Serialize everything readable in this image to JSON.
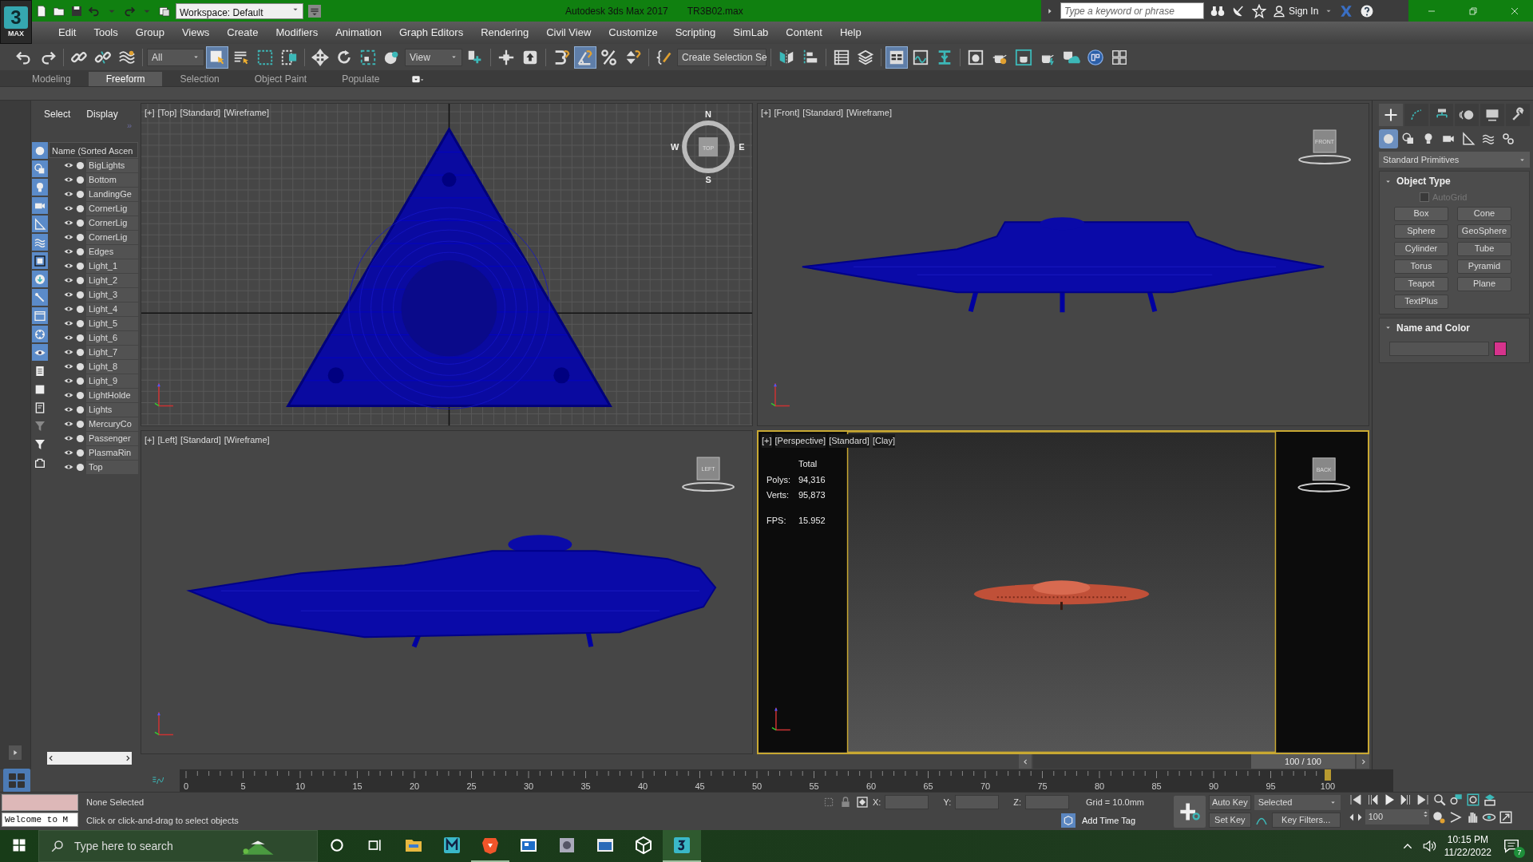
{
  "app_logo": {
    "glyph": "3",
    "label": "MAX"
  },
  "title_bar": {
    "workspace": "Workspace: Default",
    "app_title": "Autodesk 3ds Max 2017",
    "file_name": "TR3B02.max",
    "search": {
      "placeholder": "Type a keyword or phrase"
    },
    "sign_in": "Sign In"
  },
  "menu": [
    "Edit",
    "Tools",
    "Group",
    "Views",
    "Create",
    "Modifiers",
    "Animation",
    "Graph Editors",
    "Rendering",
    "Civil View",
    "Customize",
    "Scripting",
    "SimLab",
    "Content",
    "Help"
  ],
  "main_toolbar": {
    "selection_filter": "All",
    "view_dropdown": "View",
    "named_selection": "Create Selection Se",
    "buttons": [
      {
        "selected": false
      },
      {
        "selected": false
      },
      {
        "selected": false
      },
      {
        "selected": false
      },
      {
        "selected": false
      },
      {
        "selected": true
      },
      {
        "selected": false
      },
      {
        "selected": false
      },
      {
        "selected": false
      },
      {
        "selected": false
      },
      {
        "selected": false
      },
      {
        "selected": false
      },
      {
        "selected": false
      },
      {
        "selected": false
      },
      {
        "selected": false
      },
      {
        "selected": false
      },
      {
        "selected": false
      },
      {
        "selected": true
      },
      {
        "selected": false
      },
      {
        "selected": false
      },
      {
        "selected": false
      },
      {
        "selected": false
      },
      {
        "selected": false
      },
      {
        "selected": false
      },
      {
        "selected": false
      },
      {
        "selected": true
      },
      {
        "selected": false
      },
      {
        "selected": false
      },
      {
        "selected": false
      },
      {
        "selected": false
      },
      {
        "selected": false
      },
      {
        "selected": false
      },
      {
        "selected": false
      },
      {
        "selected": false
      },
      {
        "selected": false
      }
    ]
  },
  "ribbon_tabs": [
    {
      "label": "Modeling",
      "selected": false
    },
    {
      "label": "Freeform",
      "selected": true
    },
    {
      "label": "Selection",
      "selected": false
    },
    {
      "label": "Object Paint",
      "selected": false
    },
    {
      "label": "Populate",
      "selected": false
    }
  ],
  "scene_explorer": {
    "tabs": [
      "Select",
      "Display"
    ],
    "expand_glyph": "»",
    "column_header": "Name (Sorted Ascen",
    "filters": [
      {
        "selected": true
      },
      {
        "selected": true
      },
      {
        "selected": true
      },
      {
        "selected": true
      },
      {
        "selected": true
      },
      {
        "selected": true
      },
      {
        "selected": true
      },
      {
        "selected": true
      },
      {
        "selected": true
      },
      {
        "selected": true
      },
      {
        "selected": true
      },
      {
        "selected": true
      },
      {
        "selected": false
      },
      {
        "selected": false
      },
      {
        "selected": false
      },
      {
        "selected": false
      },
      {
        "selected": false
      },
      {
        "selected": false
      }
    ],
    "objects": [
      "BigLights",
      "Bottom",
      "LandingGe",
      "CornerLig",
      "CornerLig",
      "CornerLig",
      "Edges",
      "Light_1",
      "Light_2",
      "Light_3",
      "Light_4",
      "Light_5",
      "Light_6",
      "Light_7",
      "Light_8",
      "Light_9",
      "LightHolde",
      "Lights",
      "MercuryCo",
      "Passenger",
      "PlasmaRin",
      "Top"
    ]
  },
  "viewports": [
    {
      "kind": "top",
      "selected": false,
      "label": [
        "[+]",
        "[Top]",
        "[Standard]",
        "[Wireframe]"
      ],
      "viewcube": "TOP",
      "compass": [
        "N",
        "E",
        "S",
        "W"
      ]
    },
    {
      "kind": "front",
      "selected": false,
      "label": [
        "[+]",
        "[Front]",
        "[Standard]",
        "[Wireframe]"
      ],
      "viewcube": "FRONT"
    },
    {
      "kind": "left",
      "selected": false,
      "label": [
        "[+]",
        "[Left]",
        "[Standard]",
        "[Wireframe]"
      ],
      "viewcube": "LEFT"
    },
    {
      "kind": "perspective",
      "selected": true,
      "label": [
        "[+]",
        "[Perspective]",
        "[Standard]",
        "[Clay]"
      ],
      "viewcube": "BACK",
      "stats": {
        "heading": "Total",
        "rows": [
          {
            "label": "Polys:",
            "value": "94,316"
          },
          {
            "label": "Verts:",
            "value": "95,873"
          },
          {
            "label": "FPS:",
            "value": "15.952"
          }
        ]
      }
    }
  ],
  "command_panel": {
    "tabs": [
      {
        "selected": true
      },
      {
        "selected": false
      },
      {
        "selected": false
      },
      {
        "selected": false
      },
      {
        "selected": false
      },
      {
        "selected": false
      }
    ],
    "categories": [
      {
        "selected": true
      },
      {
        "selected": false
      },
      {
        "selected": false
      },
      {
        "selected": false
      },
      {
        "selected": false
      },
      {
        "selected": false
      },
      {
        "selected": false
      }
    ],
    "dropdown": "Standard Primitives",
    "object_type": {
      "title": "Object Type",
      "autogrid": {
        "label": "AutoGrid",
        "checked": false,
        "disabled": true
      },
      "buttons": [
        "Box",
        "Cone",
        "Sphere",
        "GeoSphere",
        "Cylinder",
        "Tube",
        "Torus",
        "Pyramid",
        "Teapot",
        "Plane",
        "TextPlus"
      ]
    },
    "name_and_color": {
      "title": "Name and Color",
      "color": "#d6338c"
    }
  },
  "time_slider": {
    "label": "100 / 100",
    "level": 1
  },
  "timeline": {
    "labels": [
      "0",
      "5",
      "10",
      "15",
      "20",
      "25",
      "30",
      "35",
      "40",
      "45",
      "50",
      "55",
      "60",
      "65",
      "70",
      "75",
      "80",
      "85",
      "90",
      "95",
      "100"
    ]
  },
  "status_bar": {
    "listener": "Welcome to M",
    "selection": "None Selected",
    "prompt": "Click or click-and-drag to select objects",
    "x_label": "X:",
    "y_label": "Y:",
    "z_label": "Z:",
    "grid": "Grid = 10.0mm",
    "add_time_tag": "Add Time Tag",
    "auto_key": "Auto Key",
    "key_mode": "Selected",
    "set_key": "Set Key",
    "key_filters": "Key Filters...",
    "frame": "100"
  },
  "taskbar": {
    "search": {
      "placeholder": "Type here to search"
    },
    "apps": [
      {
        "running": false,
        "selected": false
      },
      {
        "running": false,
        "selected": false
      },
      {
        "running": true,
        "selected": false
      },
      {
        "running": false,
        "selected": false
      },
      {
        "running": false,
        "selected": false
      },
      {
        "running": false,
        "selected": false
      },
      {
        "running": false,
        "selected": false
      },
      {
        "running": true,
        "selected": true
      }
    ],
    "time": "10:15 PM",
    "date": "11/22/2022",
    "notifications": "7"
  }
}
